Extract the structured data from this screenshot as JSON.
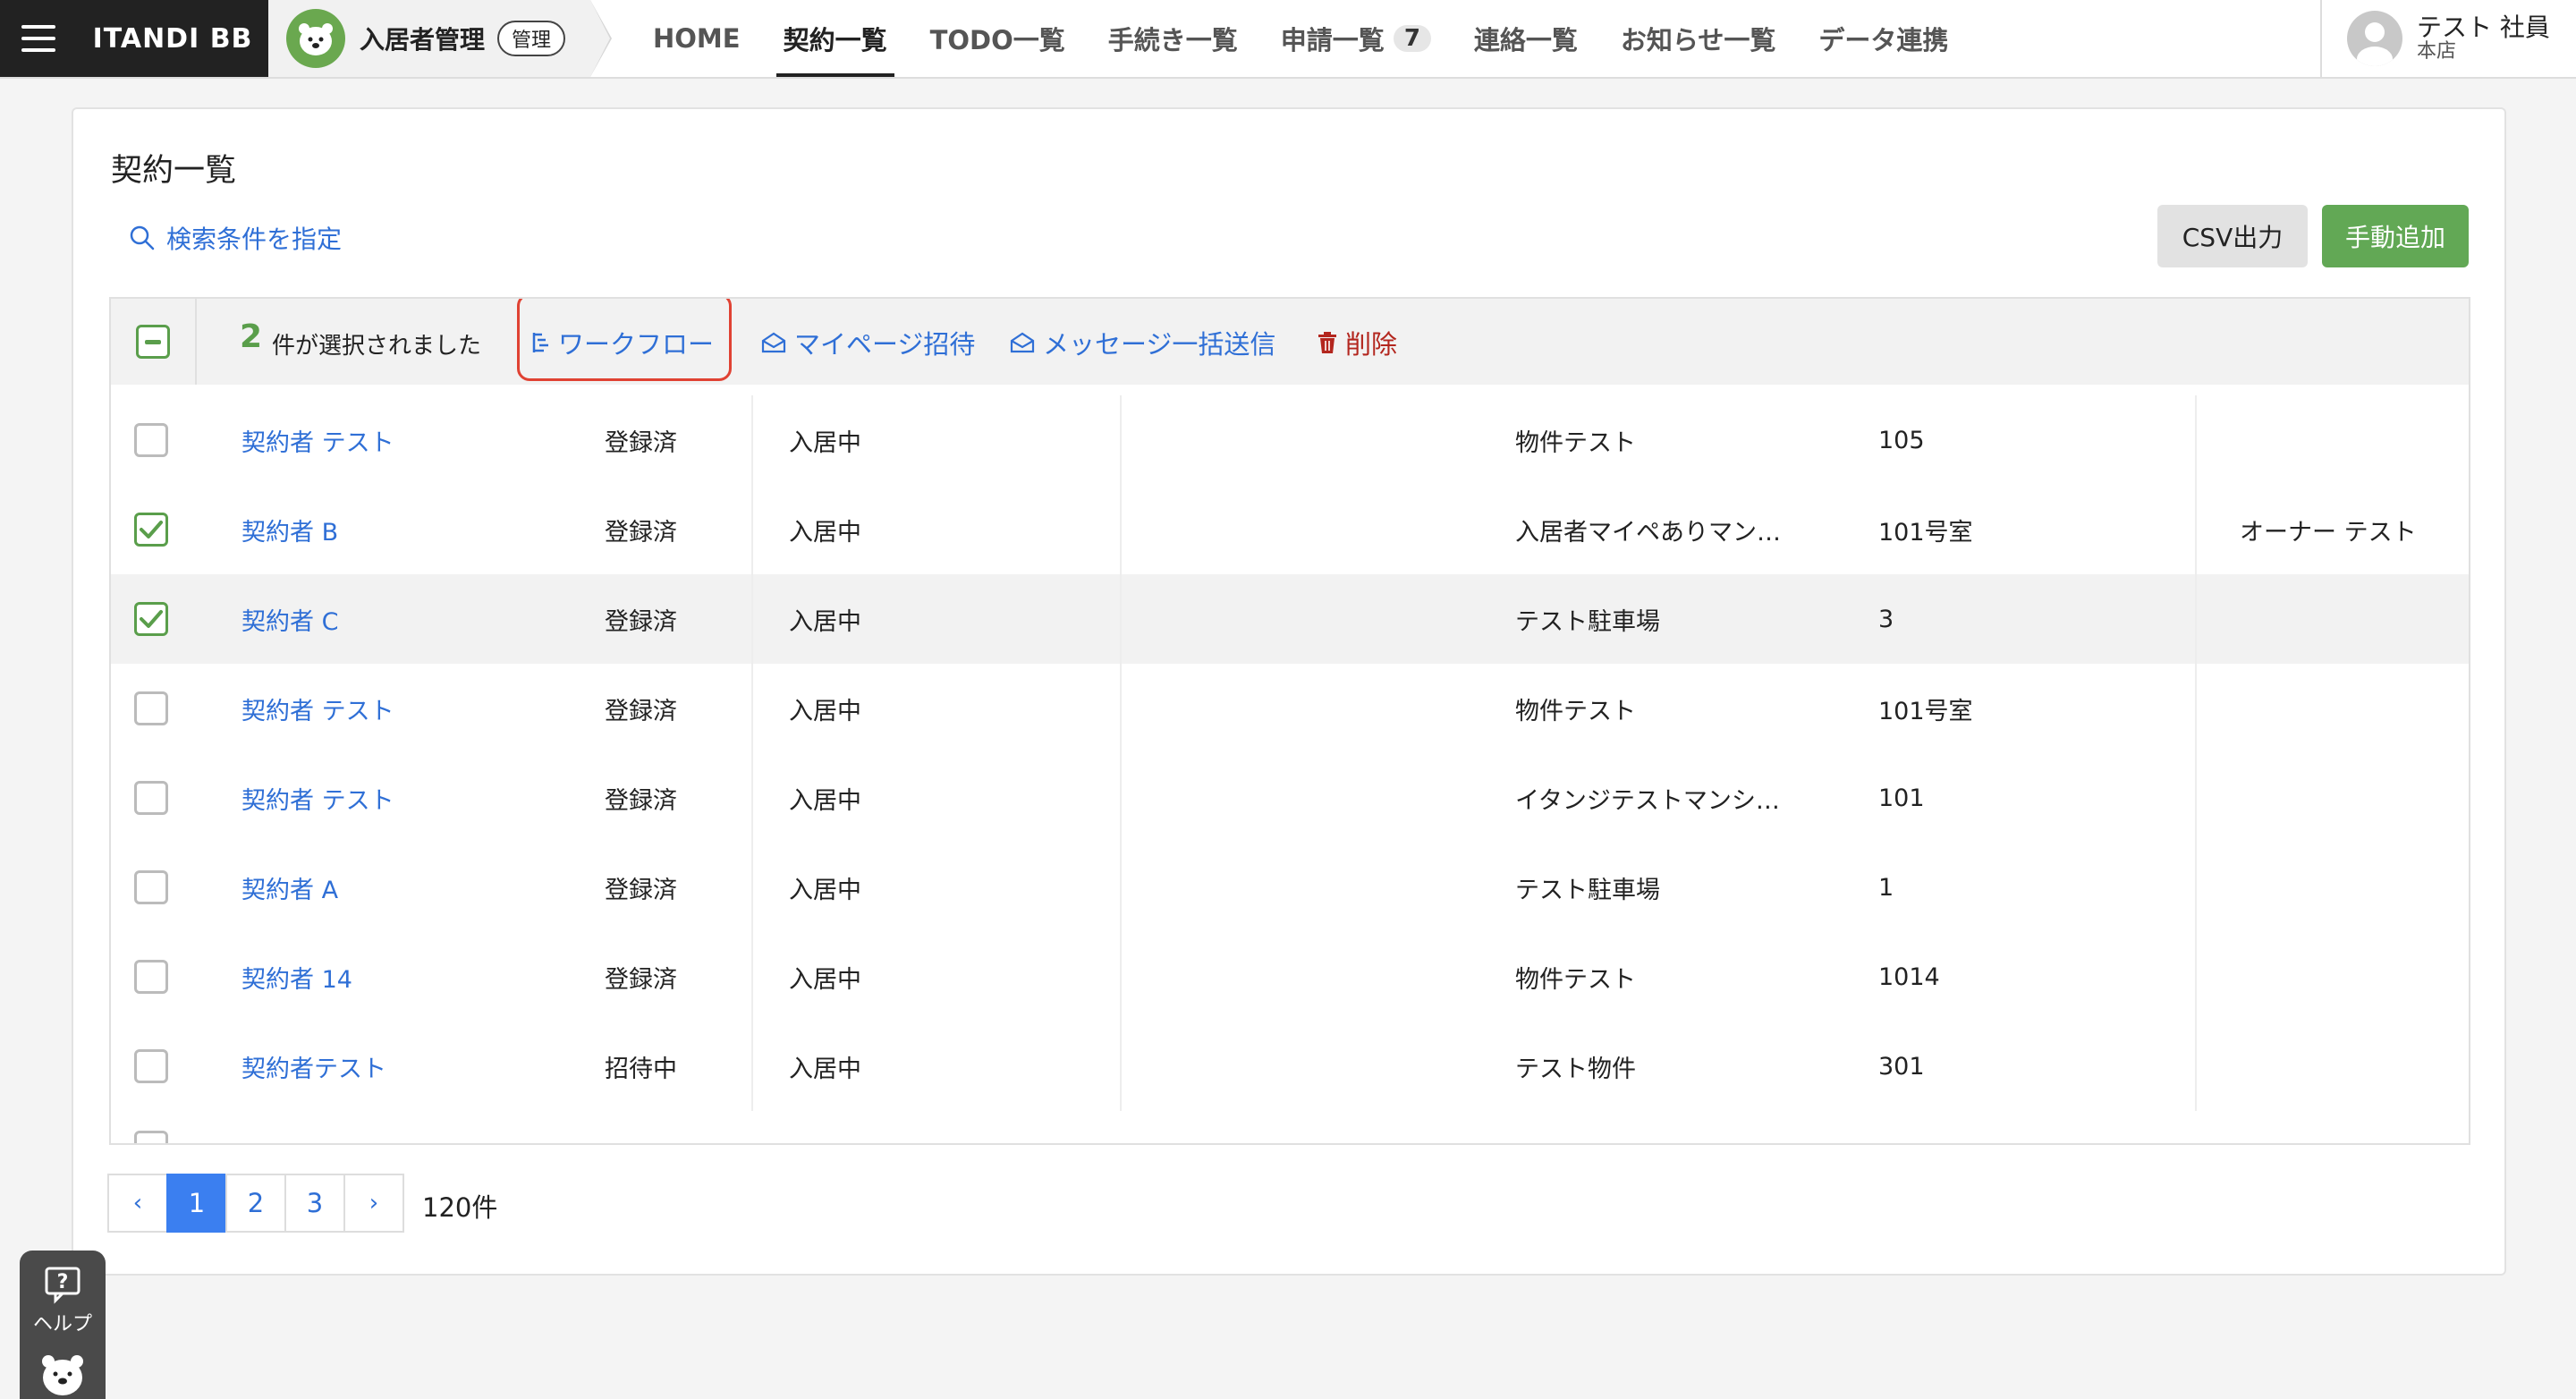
{
  "header": {
    "brand": "ITANDI BB",
    "app_title": "入居者管理",
    "app_badge": "管理",
    "nav": [
      {
        "label": "HOME"
      },
      {
        "label": "契約一覧",
        "active": true
      },
      {
        "label": "TODO一覧"
      },
      {
        "label": "手続き一覧"
      },
      {
        "label": "申請一覧",
        "count": "7"
      },
      {
        "label": "連絡一覧"
      },
      {
        "label": "お知らせ一覧"
      },
      {
        "label": "データ連携"
      }
    ],
    "user": {
      "name": "テスト 社員",
      "branch": "本店"
    }
  },
  "page": {
    "title": "契約一覧",
    "search_link": "検索条件を指定",
    "csv_button": "CSV出力",
    "add_button": "手動追加"
  },
  "bulk": {
    "selected_count": "2",
    "selected_text": "件が選択されました",
    "actions": {
      "workflow": "ワークフロー",
      "mypage_invite": "マイページ招待",
      "bulk_message": "メッセージ一括送信",
      "delete": "削除"
    }
  },
  "rows": [
    {
      "checked": false,
      "name": "契約者 テスト",
      "reg": "登録済",
      "status": "入居中",
      "property": "物件テスト",
      "room": "105",
      "owner": ""
    },
    {
      "checked": true,
      "name": "契約者 B",
      "reg": "登録済",
      "status": "入居中",
      "property": "入居者マイペありマン…",
      "room": "101号室",
      "owner": "オーナー テスト"
    },
    {
      "checked": true,
      "name": "契約者 C",
      "reg": "登録済",
      "status": "入居中",
      "property": "テスト駐車場",
      "room": "3",
      "owner": ""
    },
    {
      "checked": false,
      "name": "契約者 テスト",
      "reg": "登録済",
      "status": "入居中",
      "property": "物件テスト",
      "room": "101号室",
      "owner": ""
    },
    {
      "checked": false,
      "name": "契約者 テスト",
      "reg": "登録済",
      "status": "入居中",
      "property": "イタンジテストマンシ…",
      "room": "101",
      "owner": ""
    },
    {
      "checked": false,
      "name": "契約者 A",
      "reg": "登録済",
      "status": "入居中",
      "property": "テスト駐車場",
      "room": "1",
      "owner": ""
    },
    {
      "checked": false,
      "name": "契約者 14",
      "reg": "登録済",
      "status": "入居中",
      "property": "物件テスト",
      "room": "1014",
      "owner": ""
    },
    {
      "checked": false,
      "name": "契約者テスト",
      "reg": "招待中",
      "status": "入居中",
      "property": "テスト物件",
      "room": "301",
      "owner": ""
    }
  ],
  "pagination": {
    "prev": "‹",
    "pages": [
      "1",
      "2",
      "3"
    ],
    "current": "1",
    "next": "›",
    "total": "120件"
  },
  "help": {
    "label": "ヘルプ"
  },
  "colors": {
    "accent_green": "#62a855",
    "link_blue": "#2f6fd6",
    "danger_red": "#b3261e",
    "highlight_red": "#e04233"
  }
}
